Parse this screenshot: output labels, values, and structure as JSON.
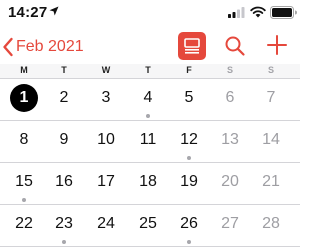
{
  "status_bar": {
    "time": "14:27"
  },
  "nav": {
    "back_label": "Feb 2021",
    "colors": {
      "accent": "#e5483c"
    }
  },
  "weekdays": [
    "M",
    "T",
    "W",
    "T",
    "F",
    "S",
    "S"
  ],
  "weeks": [
    {
      "days": [
        {
          "label": "1",
          "today": true,
          "weekend": false,
          "event": false
        },
        {
          "label": "2",
          "today": false,
          "weekend": false,
          "event": false
        },
        {
          "label": "3",
          "today": false,
          "weekend": false,
          "event": false
        },
        {
          "label": "4",
          "today": false,
          "weekend": false,
          "event": true
        },
        {
          "label": "5",
          "today": false,
          "weekend": false,
          "event": false
        },
        {
          "label": "6",
          "today": false,
          "weekend": true,
          "event": false
        },
        {
          "label": "7",
          "today": false,
          "weekend": true,
          "event": false
        }
      ]
    },
    {
      "days": [
        {
          "label": "8",
          "today": false,
          "weekend": false,
          "event": false
        },
        {
          "label": "9",
          "today": false,
          "weekend": false,
          "event": false
        },
        {
          "label": "10",
          "today": false,
          "weekend": false,
          "event": false
        },
        {
          "label": "11",
          "today": false,
          "weekend": false,
          "event": false
        },
        {
          "label": "12",
          "today": false,
          "weekend": false,
          "event": true
        },
        {
          "label": "13",
          "today": false,
          "weekend": true,
          "event": false
        },
        {
          "label": "14",
          "today": false,
          "weekend": true,
          "event": false
        }
      ]
    },
    {
      "days": [
        {
          "label": "15",
          "today": false,
          "weekend": false,
          "event": true
        },
        {
          "label": "16",
          "today": false,
          "weekend": false,
          "event": false
        },
        {
          "label": "17",
          "today": false,
          "weekend": false,
          "event": false
        },
        {
          "label": "18",
          "today": false,
          "weekend": false,
          "event": false
        },
        {
          "label": "19",
          "today": false,
          "weekend": false,
          "event": false
        },
        {
          "label": "20",
          "today": false,
          "weekend": true,
          "event": false
        },
        {
          "label": "21",
          "today": false,
          "weekend": true,
          "event": false
        }
      ]
    },
    {
      "days": [
        {
          "label": "22",
          "today": false,
          "weekend": false,
          "event": false
        },
        {
          "label": "23",
          "today": false,
          "weekend": false,
          "event": true
        },
        {
          "label": "24",
          "today": false,
          "weekend": false,
          "event": false
        },
        {
          "label": "25",
          "today": false,
          "weekend": false,
          "event": false
        },
        {
          "label": "26",
          "today": false,
          "weekend": false,
          "event": true
        },
        {
          "label": "27",
          "today": false,
          "weekend": true,
          "event": false
        },
        {
          "label": "28",
          "today": false,
          "weekend": true,
          "event": false
        }
      ]
    }
  ]
}
